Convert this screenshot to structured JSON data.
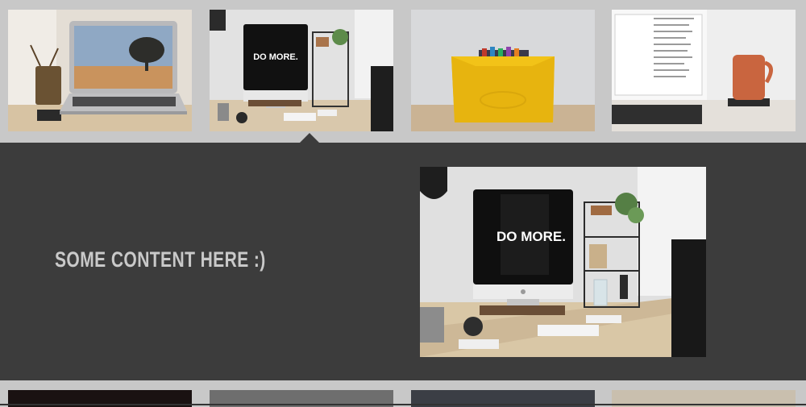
{
  "gallery": {
    "thumbnails": [
      {
        "subject": "laptop-on-desk-photo"
      },
      {
        "subject": "imac-desk-do-more-photo"
      },
      {
        "subject": "yellow-crayon-holder-photo"
      },
      {
        "subject": "laptop-with-coffee-mug-photo"
      }
    ],
    "selected_index": 1
  },
  "panel": {
    "text": "SOME CONTENT HERE :)",
    "screen_text": "DO MORE."
  },
  "thumb_screen_text": "DO MORE.",
  "colors": {
    "page_background": "#c8c8c8",
    "panel_background": "#3c3c3c",
    "panel_text": "#c9c9c9"
  }
}
